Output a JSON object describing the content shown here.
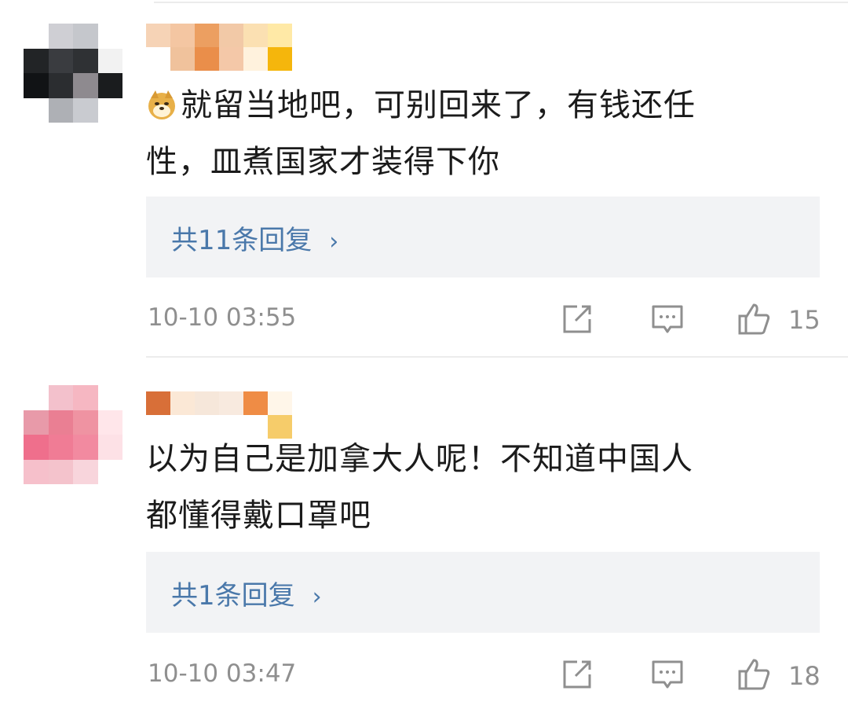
{
  "comments": [
    {
      "text_line1": "就留当地吧，可别回来了，有钱还任",
      "text_line2": "性，皿煮国家才装得下你",
      "emoji": "doge-emoji",
      "replies_label": "共11条回复",
      "time": "10-10 03:55",
      "likes": "15",
      "avatar_colors": [
        "#ffffff",
        "#cfcfd4",
        "#c5c7cc",
        "#ffffff",
        "#222426",
        "#3a3c40",
        "#2f3134",
        "#f2f2f2",
        "#111315",
        "#2b2d30",
        "#8e8a8f",
        "#1a1c1e",
        "#ffffff",
        "#aeb0b5",
        "#c9cbd0",
        "#ffffff"
      ],
      "name_colors": [
        "#f6d3b6",
        "#f4c6a2",
        "#ec9f61",
        "#f2c9a7",
        "#fbe0b2",
        "#ffe9a6",
        "#ffffff",
        "#f0c29c",
        "#ea8e4a",
        "#f4c8a8",
        "#fff2dd",
        "#f5b60c"
      ]
    },
    {
      "text_line1": "以为自己是加拿大人呢！不知道中国人",
      "text_line2": "都懂得戴口罩吧",
      "replies_label": "共1条回复",
      "time": "10-10 03:47",
      "likes": "18",
      "avatar_colors": [
        "#ffffff",
        "#f3c1cc",
        "#f6b7c2",
        "#ffffff",
        "#e89aa9",
        "#ea7f93",
        "#ef93a2",
        "#ffe6ea",
        "#ef6f8c",
        "#f07c95",
        "#f28aa0",
        "#fde1e6",
        "#f6c0cb",
        "#f4c3cc",
        "#f8d5dc",
        "#ffffff"
      ],
      "name_colors": [
        "#d86f38",
        "#fbe8d6",
        "#f6e7da",
        "#f8eadf",
        "#ef8c45",
        "#fff6e9",
        "#ffffff",
        "#ffffff",
        "#ffffff",
        "#ffffff",
        "#ffffff",
        "#f6cc6a"
      ]
    }
  ],
  "icons": {
    "share": "share-icon",
    "reply": "reply-icon",
    "like": "like-icon",
    "chevron": "chevron-right-icon"
  },
  "colors": {
    "link": "#4a78aa",
    "meta": "#8f8f8f",
    "reply_bg": "#f2f3f5"
  }
}
